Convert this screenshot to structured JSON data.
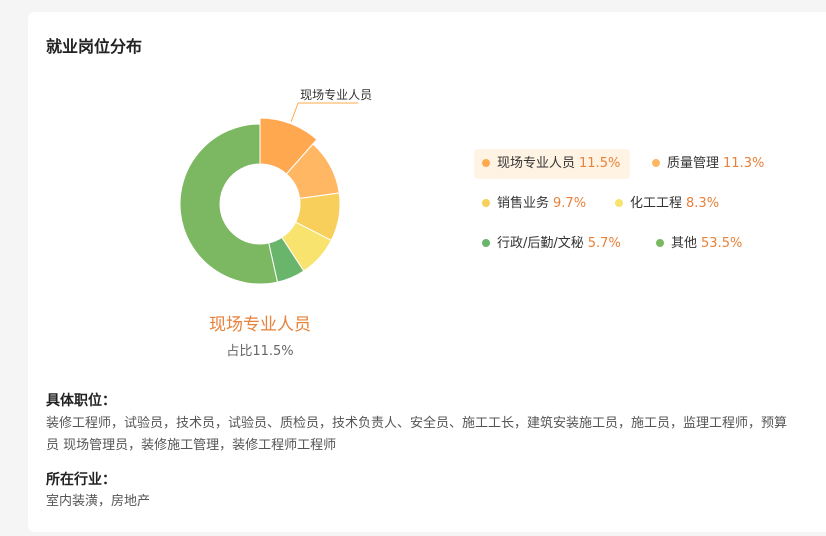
{
  "header": {
    "title": "就业岗位分布"
  },
  "chart_data": {
    "type": "pie",
    "categories": [
      "现场专业人员",
      "质量管理",
      "销售业务",
      "化工工程",
      "行政/后勤/文秘",
      "其他"
    ],
    "values": [
      11.5,
      11.3,
      9.7,
      8.3,
      5.7,
      53.5
    ],
    "percent_labels": [
      "11.5%",
      "11.3%",
      "9.7%",
      "8.3%",
      "5.7%",
      "53.5%"
    ],
    "colors": [
      "#ffa84f",
      "#ffb764",
      "#f7cf5a",
      "#f7e36e",
      "#69b56b",
      "#7cb862"
    ],
    "highlighted": "现场专业人员",
    "callout_label": "现场专业人员",
    "legend_position": "right"
  },
  "selected": {
    "name": "现场专业人员",
    "share_text": "占比11.5%"
  },
  "details": {
    "positions_label": "具体职位：",
    "positions_text": "装修工程师，试验员，技术员，试验员、质检员，技术负责人、安全员、施工工长，建筑安装施工员，施工员，监理工程师，预算员 现场管理员，装修施工管理，装修工程师工程师",
    "industry_label": "所在行业：",
    "industry_text": "室内装潢，房地产"
  }
}
